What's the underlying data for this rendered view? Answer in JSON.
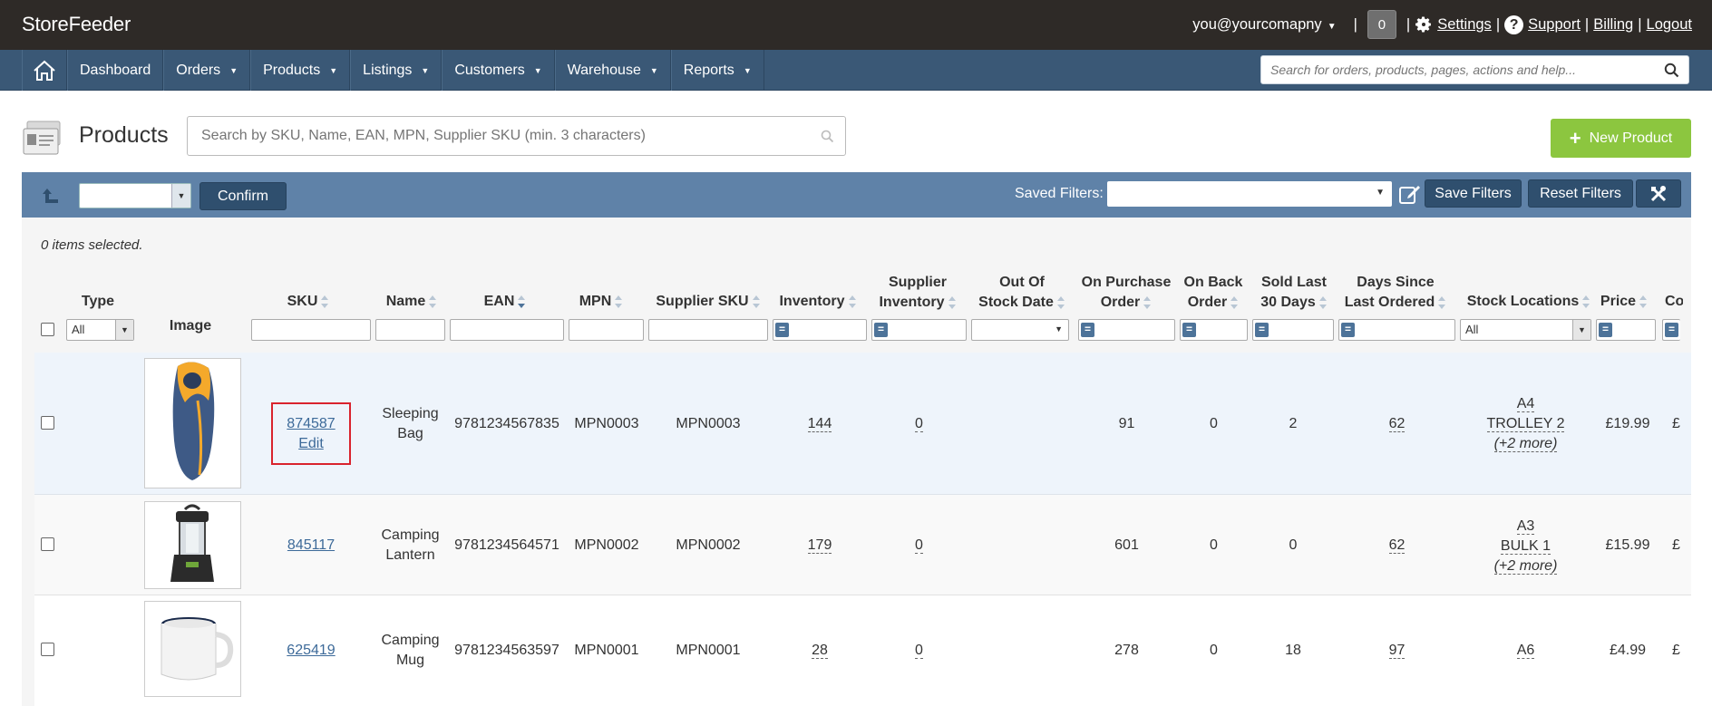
{
  "app": {
    "brand": "StoreFeeder"
  },
  "topbar": {
    "user_email": "you@yourcomapny",
    "notifications": "0",
    "separator": "|",
    "links": [
      "Settings",
      "Support",
      "Billing",
      "Logout"
    ]
  },
  "nav": {
    "items": [
      "Dashboard",
      "Orders",
      "Products",
      "Listings",
      "Customers",
      "Warehouse",
      "Reports"
    ],
    "search_placeholder": "Search for orders, products, pages, actions and help..."
  },
  "page": {
    "title": "Products",
    "search_placeholder": "Search by SKU, Name, EAN, MPN, Supplier SKU (min. 3 characters)",
    "new_button": "New Product"
  },
  "filterbar": {
    "confirm": "Confirm",
    "saved_filters_label": "Saved Filters:",
    "save_filters": "Save Filters",
    "reset_filters": "Reset Filters"
  },
  "grid": {
    "selected_text": "0 items selected.",
    "headers": {
      "type": "Type",
      "image": "Image",
      "sku": "SKU",
      "name": "Name",
      "ean": "EAN",
      "mpn": "MPN",
      "supplier_sku": "Supplier SKU",
      "inventory": "Inventory",
      "supplier_inventory_1": "Supplier",
      "supplier_inventory_2": "Inventory",
      "out_of_stock_1": "Out Of",
      "out_of_stock_2": "Stock Date",
      "on_purchase_1": "On Purchase",
      "on_purchase_2": "Order",
      "on_back_1": "On Back",
      "on_back_2": "Order",
      "sold_last_1": "Sold Last",
      "sold_last_2": "30 Days",
      "days_since_1": "Days Since",
      "days_since_2": "Last Ordered",
      "stock_locations": "Stock Locations",
      "price": "Price",
      "cost": "Co"
    },
    "filters": {
      "type_all": "All",
      "locations_all": "All",
      "eq": "="
    },
    "rows": [
      {
        "sku": "874587",
        "edit": "Edit",
        "name1": "Sleeping",
        "name2": "Bag",
        "ean": "9781234567835",
        "mpn": "MPN0003",
        "supplier_sku": "MPN0003",
        "inventory": "144",
        "supplier_inventory": "0",
        "on_purchase": "91",
        "on_back": "0",
        "sold_last": "2",
        "days_since": "62",
        "loc1": "A4",
        "loc2": "TROLLEY 2",
        "more": "(+2 more)",
        "price": "£19.99",
        "cost": "£"
      },
      {
        "sku": "845117",
        "name1": "Camping",
        "name2": "Lantern",
        "ean": "9781234564571",
        "mpn": "MPN0002",
        "supplier_sku": "MPN0002",
        "inventory": "179",
        "supplier_inventory": "0",
        "on_purchase": "601",
        "on_back": "0",
        "sold_last": "0",
        "days_since": "62",
        "loc1": "A3",
        "loc2": "BULK 1",
        "more": "(+2 more)",
        "price": "£15.99",
        "cost": "£"
      },
      {
        "sku": "625419",
        "name1": "Camping",
        "name2": "Mug",
        "ean": "9781234563597",
        "mpn": "MPN0001",
        "supplier_sku": "MPN0001",
        "inventory": "28",
        "supplier_inventory": "0",
        "on_purchase": "278",
        "on_back": "0",
        "sold_last": "18",
        "days_since": "97",
        "loc1": "A6",
        "price": "£4.99",
        "cost": "£"
      }
    ]
  },
  "colors": {
    "topbar": "#2e2a27",
    "nav": "#3a5876",
    "filterbar": "#5f82a8",
    "new_button": "#8cc63f",
    "link": "#3d6a99",
    "highlight": "#d9232d"
  }
}
